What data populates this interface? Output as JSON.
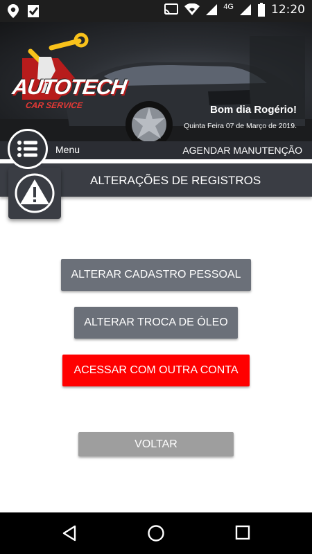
{
  "status_bar": {
    "time": "12:20",
    "network": "4G",
    "icons": [
      "location-pin-icon",
      "check-flag-icon",
      "cast-icon",
      "wifi-icon",
      "signal-icon",
      "battery-icon"
    ]
  },
  "banner": {
    "logo_title": "AUTOTECH",
    "logo_subtitle": "CAR SERVICE",
    "greeting": "Bom dia Rogério!",
    "date": "Quinta Feira 07 de Março de 2019."
  },
  "menu_bar": {
    "menu_label": "Menu",
    "schedule_label": "AGENDAR MANUTENÇÃO"
  },
  "section": {
    "title": "ALTERAÇÕES DE REGISTROS",
    "icon": "warning-icon"
  },
  "actions": {
    "personal_label": "ALTERAR CADASTRO PESSOAL",
    "oil_label": "ALTERAR TROCA DE ÓLEO",
    "account_label": "ACESSAR COM OUTRA CONTA",
    "back_label": "VOLTAR"
  },
  "colors": {
    "header_dark": "#2b2d33",
    "section_bg": "#3a3d44",
    "gray_button": "#6b7079",
    "danger_button": "#ff0000",
    "back_button": "#9e9e9e"
  },
  "nav_bar": {
    "icons": [
      "back-triangle-icon",
      "home-circle-icon",
      "recents-square-icon"
    ]
  }
}
